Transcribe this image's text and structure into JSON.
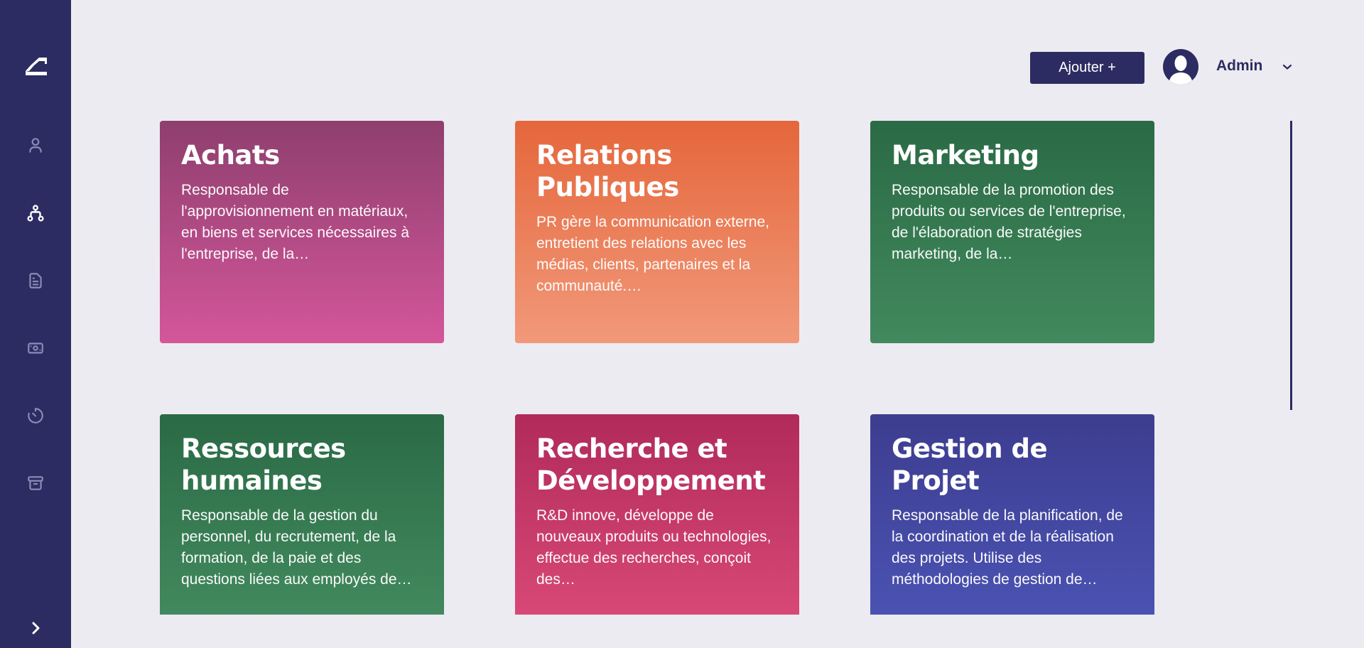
{
  "colors": {
    "sidebar": "#2c2c62",
    "background": "#ecebf1",
    "nav_inactive": "#8b8bb8",
    "nav_active": "#ffffff"
  },
  "sidebar": {
    "logo": "app-logo",
    "items": [
      {
        "icon": "user-icon",
        "active": false
      },
      {
        "icon": "org-chart-icon",
        "active": true
      },
      {
        "icon": "document-icon",
        "active": false
      },
      {
        "icon": "money-icon",
        "active": false
      },
      {
        "icon": "timer-icon",
        "active": false
      },
      {
        "icon": "archive-icon",
        "active": false
      }
    ],
    "expand_icon": "chevron-right-icon"
  },
  "header": {
    "add_button_label": "Ajouter +",
    "user_name": "Admin"
  },
  "cards": [
    {
      "title": "Achats",
      "description": "Responsable de l'approvisionnement en matériaux, en biens et services nécessaires à l'entreprise, de la…",
      "gradient": [
        "#8e3f6e",
        "#d4569b"
      ]
    },
    {
      "title": "Relations Publiques",
      "description": "PR gère la communication externe, entretient des relations avec les médias, clients, partenaires et la communauté.…",
      "gradient": [
        "#e5663b",
        "#f1997a"
      ]
    },
    {
      "title": "Marketing",
      "description": "Responsable de la promotion des produits ou services de l'entreprise, de l'élaboration de stratégies marketing, de la…",
      "gradient": [
        "#2a6a45",
        "#42895e"
      ]
    },
    {
      "title": "Ressources humaines",
      "description": "Responsable de la gestion du personnel, du recrutement, de la formation, de la paie et des questions liées aux employés de…",
      "gradient": [
        "#2a6a45",
        "#42895e"
      ]
    },
    {
      "title": "Recherche et Développement",
      "description": "R&D innove, développe de nouveaux produits ou technologies, effectue des recherches, conçoit des…",
      "gradient": [
        "#b02a5a",
        "#d84876"
      ]
    },
    {
      "title": "Gestion de Projet",
      "description": "Responsable de la planification, de la coordination et de la réalisation des projets. Utilise des méthodologies de gestion de…",
      "gradient": [
        "#3d3d8f",
        "#4a52b2"
      ]
    }
  ]
}
